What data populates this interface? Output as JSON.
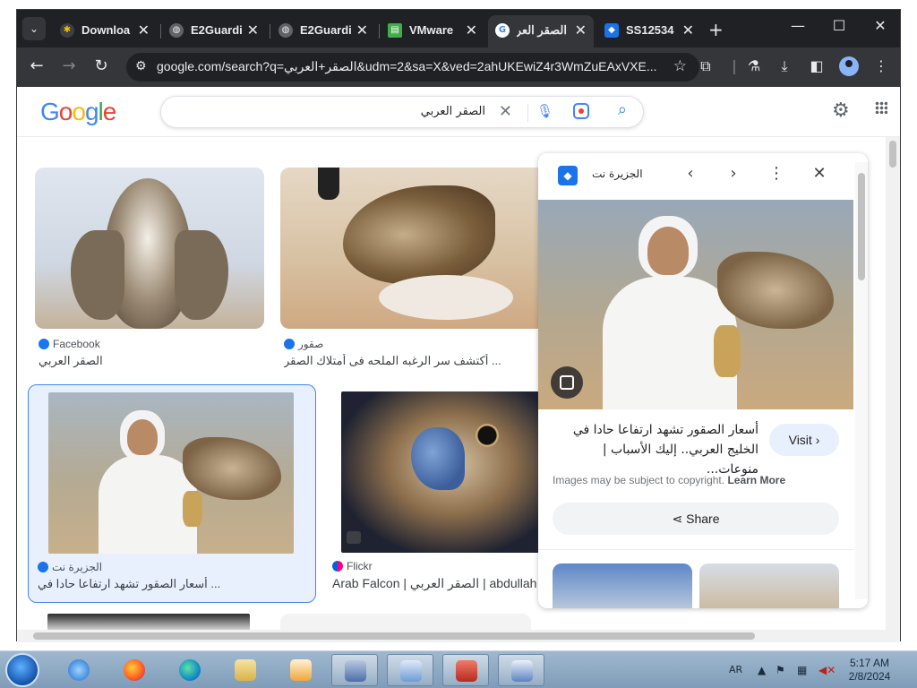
{
  "browser": {
    "tabs": [
      {
        "title": "Downloa",
        "icon": "download-icon"
      },
      {
        "title": "E2Guardi",
        "icon": "globe-icon"
      },
      {
        "title": "E2Guardi",
        "icon": "globe-icon"
      },
      {
        "title": "VMware",
        "icon": "vmware-icon"
      },
      {
        "title": "الصقر العر",
        "icon": "google-icon"
      },
      {
        "title": "SS12534",
        "icon": "water-drop-icon"
      }
    ],
    "url": "google.com/search?q=الصقر+العربي&udm=2&sa=X&ved=2ahUKEwiZ4r3WmZuEAxVXE..."
  },
  "search": {
    "query": "الصقر العربي"
  },
  "results": [
    {
      "source": "Facebook",
      "caption": "الصقر العربي"
    },
    {
      "source": "صقور",
      "caption": "... أكتشف سر الرغبه الملحه فى أمتلاك الصقر"
    },
    {
      "source": "الجزيرة نت",
      "caption": "... أسعار الصقور تشهد ارتفاعا حادا في"
    },
    {
      "source": "Flickr",
      "caption": "Arab Falcon | الصقر العربي | abdullah ..."
    }
  ],
  "panel": {
    "site_name": "الجزيرة نت",
    "title": "أسعار الصقور تشهد ارتفاعا حادا في الخليج العربي.. إليك الأسباب | منوعات...",
    "visit_label": "Visit",
    "copyright_text": "Images may be subject to copyright.",
    "learn_more": "Learn More",
    "share_label": "Share"
  },
  "taskbar": {
    "language": "AR",
    "time": "5:17 AM",
    "date": "2/8/2024"
  }
}
